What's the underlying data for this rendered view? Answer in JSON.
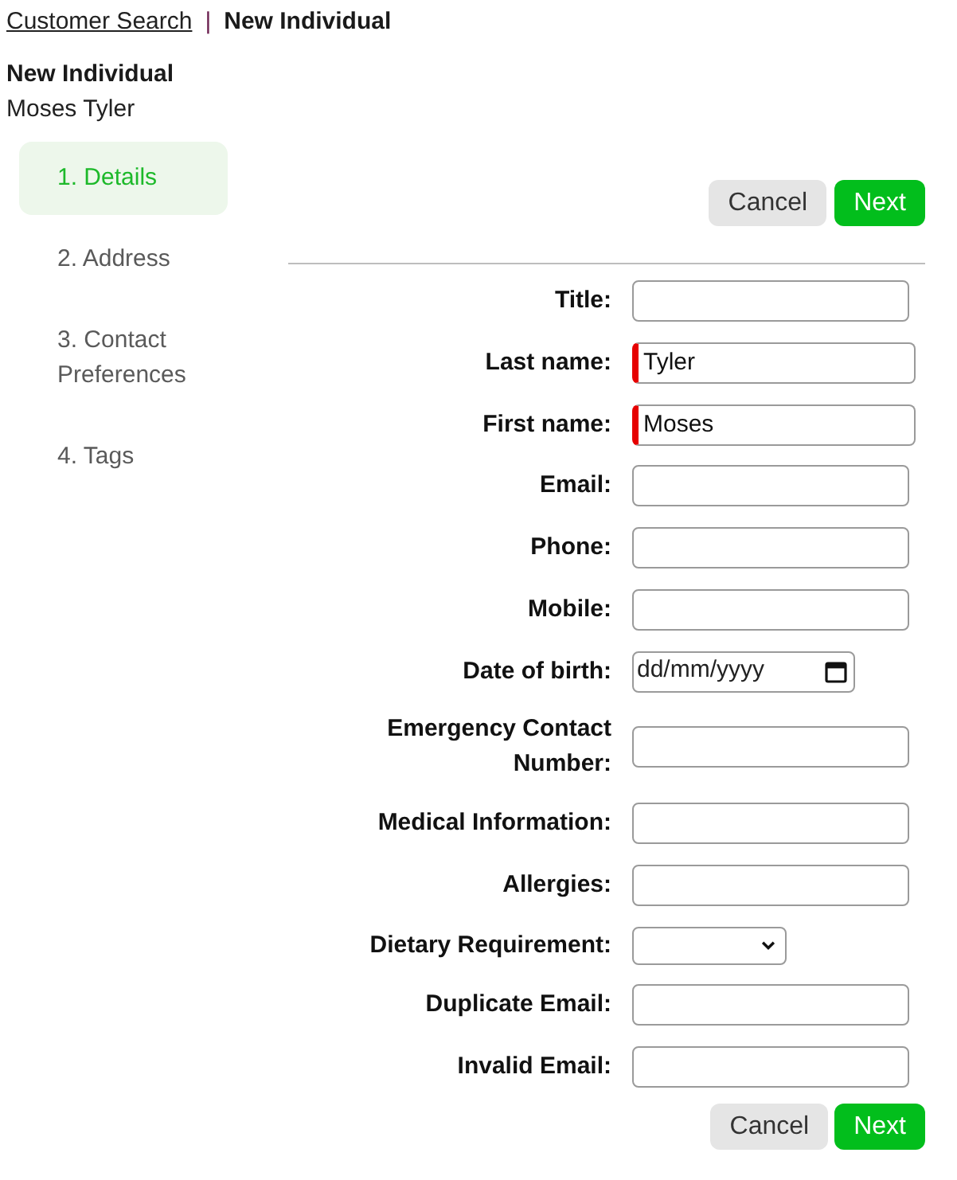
{
  "breadcrumb": {
    "link": "Customer Search",
    "separator": "|",
    "current": "New Individual"
  },
  "header": {
    "title": "New Individual",
    "subtitle": "Moses Tyler"
  },
  "steps": [
    {
      "label": "1. Details",
      "selected": true
    },
    {
      "label": "2. Address",
      "selected": false
    },
    {
      "label": "3. Contact Preferences",
      "selected": false
    },
    {
      "label": "4. Tags",
      "selected": false
    }
  ],
  "top_actions": [
    {
      "label": "Cancel",
      "kind": "secondary"
    },
    {
      "label": "Next",
      "kind": "primary"
    }
  ],
  "form": {
    "fields": [
      {
        "label": "Title:",
        "kind": "text",
        "required": false
      },
      {
        "label": "Last name:",
        "kind": "text",
        "required": true,
        "value": "Tyler"
      },
      {
        "label": "First name:",
        "kind": "text",
        "required": true,
        "value": "Moses"
      },
      {
        "label": "Email:",
        "kind": "text",
        "required": false
      },
      {
        "label": "Phone:",
        "kind": "text",
        "required": false
      },
      {
        "label": "Mobile:",
        "kind": "text",
        "required": false
      },
      {
        "label": "Date of birth:",
        "kind": "date",
        "required": false,
        "placeholder": "dd/mm/yyyy"
      },
      {
        "label": "Emergency Contact Number:",
        "kind": "text",
        "required": false
      },
      {
        "label": "Medical Information:",
        "kind": "text",
        "required": false
      },
      {
        "label": "Allergies:",
        "kind": "text",
        "required": false
      },
      {
        "label": "Dietary Requirement:",
        "kind": "select",
        "required": false
      },
      {
        "label": "Duplicate Email:",
        "kind": "text",
        "required": false
      },
      {
        "label": "Invalid Email:",
        "kind": "text",
        "required": false
      }
    ]
  },
  "bottom_actions": [
    {
      "label": "Cancel",
      "kind": "secondary"
    },
    {
      "label": "Next",
      "kind": "primary"
    }
  ]
}
